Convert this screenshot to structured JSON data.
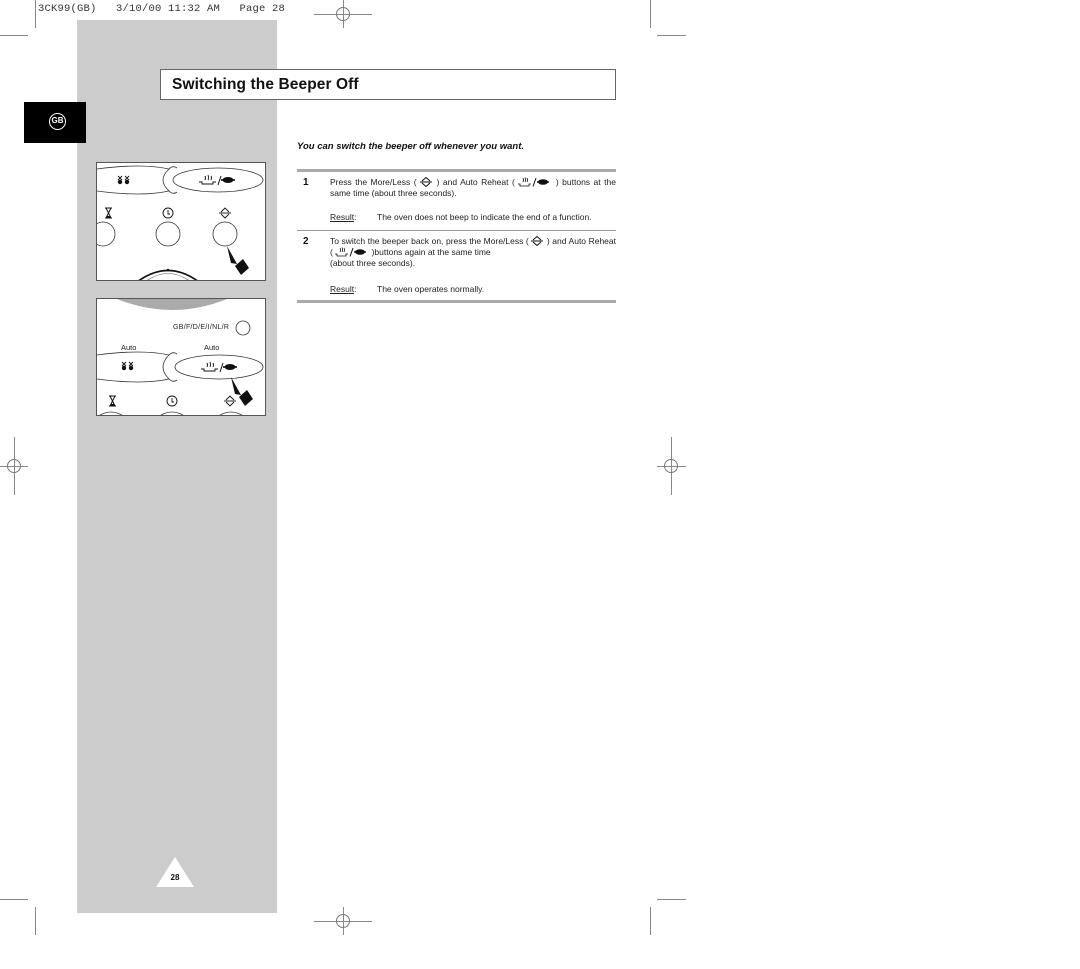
{
  "print_header": "3CK99(GB)   3/10/00 11:32 AM   Page 28",
  "language_tab": "GB",
  "title": "Switching the Beeper Off",
  "intro": "You can switch the beeper off whenever you want.",
  "steps": [
    {
      "number": "1",
      "text_a": "Press the More/Less (",
      "text_b": ") and Auto Reheat (",
      "text_c": ") buttons at the same time (about three seconds).",
      "result_label": "Result",
      "result_text": "The oven does not beep to indicate the end of a function."
    },
    {
      "number": "2",
      "text_a": "To switch the beeper back on, press the More/Less (",
      "text_b": ") and Auto Reheat (",
      "text_c": ")buttons again at the same time",
      "text_d": "(about three seconds).",
      "result_label": "Result",
      "result_text": "The oven operates normally."
    }
  ],
  "panel_bottom": {
    "language_label": "GB/F/D/E/I/NL/R",
    "auto_left": "Auto",
    "auto_right": "Auto"
  },
  "icons": {
    "more_less": "more-less-icon",
    "auto_reheat": "auto-reheat-icon",
    "auto_defrost": "auto-defrost-icon",
    "timer": "hourglass-icon",
    "clock": "clock-icon"
  },
  "page_number": "28"
}
